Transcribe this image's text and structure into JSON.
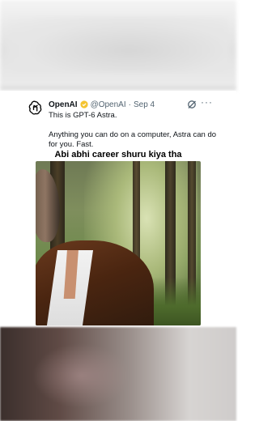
{
  "tweet": {
    "author": "OpenAI",
    "handle": "@OpenAI",
    "separator": "·",
    "date": "Sep 4",
    "more": "···",
    "lines": [
      "This is GPT-6 Astra.",
      "Anything you can do on a computer, Astra can do",
      "for you. Fast."
    ]
  },
  "media": {
    "caption": "Abi abhi career shuru kiya tha"
  },
  "colors": {
    "verified": "#F4C430",
    "text": "#0F1419",
    "secondary": "#536471"
  },
  "icons": [
    "openai-logo-icon",
    "verified-badge-icon",
    "grok-icon",
    "more-icon"
  ]
}
